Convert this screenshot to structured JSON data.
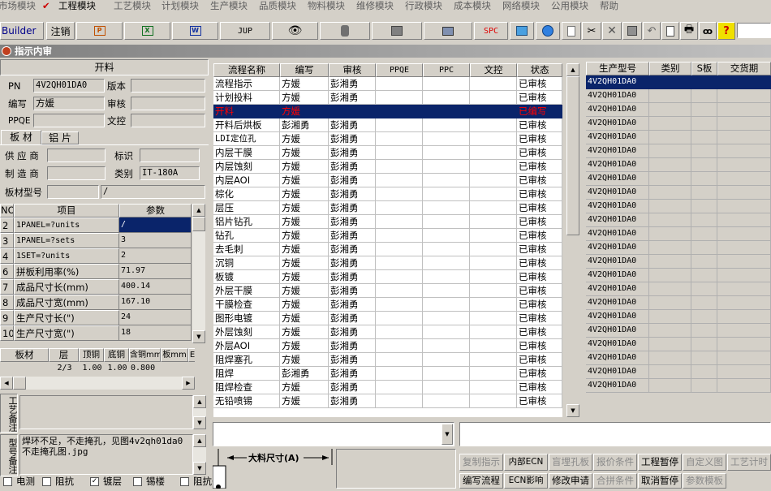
{
  "menu": [
    "市场模块",
    "工程模块",
    "工艺模块",
    "计划模块",
    "生产模块",
    "品质模块",
    "物料模块",
    "维修模块",
    "行政模块",
    "成本模块",
    "网络模块",
    "公用模块",
    "帮助"
  ],
  "toolbar": {
    "builder": "Builder",
    "logout": "注销",
    "jup": "JUP",
    "spc": "SPC",
    "input_value": ""
  },
  "window_title": "指示内审",
  "form": {
    "header": "开料",
    "pn_label": "PN",
    "pn_value": "4V2QH01DA0",
    "version_label": "版本",
    "version_value": "",
    "writer_label": "编写",
    "writer_value": "方媛",
    "review_label": "审核",
    "review_value": "",
    "ppqe_label": "PPQE",
    "ppqe_value": "",
    "doc_label": "文控",
    "doc_value": ""
  },
  "tabs": [
    "板 材",
    "铝 片"
  ],
  "material": {
    "supplier_label": "供 应 商",
    "supplier_value": "",
    "mark_label": "标识",
    "mark_value": "",
    "maker_label": "制 造 商",
    "maker_value": "",
    "category_label": "类别",
    "category_value": "IT-180A",
    "type_label": "板材型号",
    "type_value": "",
    "type_value2": "/"
  },
  "params": {
    "headers": [
      "NO",
      "项目",
      "参数"
    ],
    "rows": [
      [
        "2",
        "1PANEL=?units",
        "/"
      ],
      [
        "3",
        "1PANEL=?sets",
        "3"
      ],
      [
        "4",
        "1SET=?units",
        "2"
      ],
      [
        "6",
        "拼板利用率(%)",
        "71.97"
      ],
      [
        "7",
        "成品尺寸长(mm)",
        "400.14"
      ],
      [
        "8",
        "成品尺寸宽(mm)",
        "167.10"
      ],
      [
        "9",
        "生产尺寸长(\")",
        "24"
      ],
      [
        "10",
        "生产尺寸宽(\")",
        "18"
      ]
    ]
  },
  "layers": {
    "headers": [
      "板材",
      "层",
      "顶铜",
      "底铜",
      "含铜mm",
      "板mm",
      "E"
    ],
    "row": [
      "",
      "2/3",
      "1.00",
      "1.00",
      "0.800",
      ""
    ]
  },
  "notes": {
    "process_label": "工艺备注",
    "process_text": "",
    "model_label": "型号备注",
    "model_text": "焊环不足，不走掩孔，见图4v2qh01da0不走掩孔图.jpg"
  },
  "checkboxes": [
    {
      "label": "电测",
      "checked": false
    },
    {
      "label": "阻抗",
      "checked": false
    },
    {
      "label": "镀层",
      "checked": true
    },
    {
      "label": "锡楼",
      "checked": false
    },
    {
      "label": "阻抗条",
      "checked": false
    }
  ],
  "process": {
    "headers": [
      "流程名称",
      "编写",
      "审核",
      "PPQE",
      "PPC",
      "文控",
      "状态"
    ],
    "rows": [
      [
        "流程指示",
        "方媛",
        "彭湘勇",
        "",
        "",
        "",
        "已审核"
      ],
      [
        "计划投料",
        "方媛",
        "彭湘勇",
        "",
        "",
        "",
        "已审核"
      ],
      [
        "开料",
        "方媛",
        "",
        "",
        "",
        "",
        "已编写"
      ],
      [
        "开料后烘板",
        "彭湘勇",
        "彭湘勇",
        "",
        "",
        "",
        "已审核"
      ],
      [
        "LDI定位孔",
        "方媛",
        "彭湘勇",
        "",
        "",
        "",
        "已审核"
      ],
      [
        "内层干膜",
        "方媛",
        "彭湘勇",
        "",
        "",
        "",
        "已审核"
      ],
      [
        "内层蚀刻",
        "方媛",
        "彭湘勇",
        "",
        "",
        "",
        "已审核"
      ],
      [
        "内层AOI",
        "方媛",
        "彭湘勇",
        "",
        "",
        "",
        "已审核"
      ],
      [
        "棕化",
        "方媛",
        "彭湘勇",
        "",
        "",
        "",
        "已审核"
      ],
      [
        "层压",
        "方媛",
        "彭湘勇",
        "",
        "",
        "",
        "已审核"
      ],
      [
        "铝片钻孔",
        "方媛",
        "彭湘勇",
        "",
        "",
        "",
        "已审核"
      ],
      [
        "钻孔",
        "方媛",
        "彭湘勇",
        "",
        "",
        "",
        "已审核"
      ],
      [
        "去毛刺",
        "方媛",
        "彭湘勇",
        "",
        "",
        "",
        "已审核"
      ],
      [
        "沉铜",
        "方媛",
        "彭湘勇",
        "",
        "",
        "",
        "已审核"
      ],
      [
        "板镀",
        "方媛",
        "彭湘勇",
        "",
        "",
        "",
        "已审核"
      ],
      [
        "外层干膜",
        "方媛",
        "彭湘勇",
        "",
        "",
        "",
        "已审核"
      ],
      [
        "干膜检查",
        "方媛",
        "彭湘勇",
        "",
        "",
        "",
        "已审核"
      ],
      [
        "图形电镀",
        "方媛",
        "彭湘勇",
        "",
        "",
        "",
        "已审核"
      ],
      [
        "外层蚀刻",
        "方媛",
        "彭湘勇",
        "",
        "",
        "",
        "已审核"
      ],
      [
        "外层AOI",
        "方媛",
        "彭湘勇",
        "",
        "",
        "",
        "已审核"
      ],
      [
        "阻焊塞孔",
        "方媛",
        "彭湘勇",
        "",
        "",
        "",
        "已审核"
      ],
      [
        "阻焊",
        "彭湘勇",
        "彭湘勇",
        "",
        "",
        "",
        "已审核"
      ],
      [
        "阻焊检查",
        "方媛",
        "彭湘勇",
        "",
        "",
        "",
        "已审核"
      ],
      [
        "无铅喷锡",
        "方媛",
        "彭湘勇",
        "",
        "",
        "",
        "已审核"
      ]
    ],
    "selected_index": 2
  },
  "products": {
    "headers": [
      "生产型号",
      "类别",
      "S板",
      "交货期"
    ],
    "rows": [
      "4V2QH01DA0",
      "4V2QH01DA0",
      "4V2QH01DA0",
      "4V2QH01DA0",
      "4V2QH01DA0",
      "4V2QH01DA0",
      "4V2QH01DA0",
      "4V2QH01DA0",
      "4V2QH01DA0",
      "4V2QH01DA0",
      "4V2QH01DA0",
      "4V2QH01DA0",
      "4V2QH01DA0",
      "4V2QH01DA0",
      "4V2QH01DA0",
      "4V2QH01DA0",
      "4V2QH01DA0",
      "4V2QH01DA0",
      "4V2QH01DA0",
      "4V2QH01DA0",
      "4V2QH01DA0",
      "4V2QH01DA0",
      "4V2QH01DA0"
    ]
  },
  "diagram": {
    "label": "大料尺寸(A)"
  },
  "buttons_row1": [
    {
      "label": "复制指示",
      "enabled": false
    },
    {
      "label": "内部ECN",
      "enabled": true
    },
    {
      "label": "盲埋孔板",
      "enabled": false
    },
    {
      "label": "报价条件",
      "enabled": false
    },
    {
      "label": "工程暂停",
      "enabled": true
    },
    {
      "label": "自定义图",
      "enabled": false
    },
    {
      "label": "工艺计时",
      "enabled": false
    }
  ],
  "buttons_row2": [
    {
      "label": "编写流程",
      "enabled": true
    },
    {
      "label": "ECN影响",
      "enabled": true
    },
    {
      "label": "修改申请",
      "enabled": true
    },
    {
      "label": "合拼条件",
      "enabled": false
    },
    {
      "label": "取消暂停",
      "enabled": true
    },
    {
      "label": "参数模板",
      "enabled": false
    }
  ],
  "colors": {
    "selection": "#0a246a",
    "selected_text": "#ff0000",
    "face": "#d4d0c8",
    "title_start": "#808080"
  }
}
